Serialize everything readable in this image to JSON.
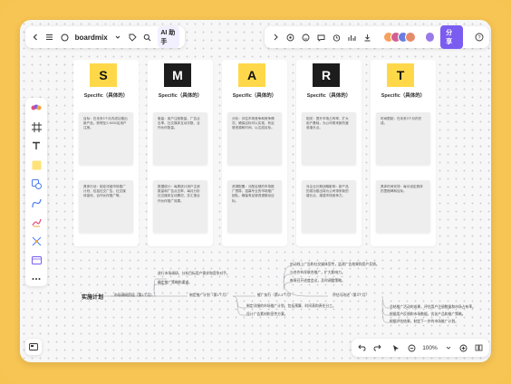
{
  "toolbar_left": {
    "back_icon": "chevron-left-icon",
    "menu_icon": "menu-icon",
    "brand": "boardmix",
    "tag_icon": "tag-icon",
    "search_icon": "search-icon",
    "ai_label": "AI 助手"
  },
  "toolbar_right": {
    "share_label": "分享",
    "help_icon": "help-icon"
  },
  "sidebar": {
    "items": [
      "logo-icon",
      "frame-icon",
      "text-icon",
      "sticky-note-icon",
      "shape-icon",
      "connector-icon",
      "pen-icon",
      "mindmap-icon",
      "template-icon",
      "more-icon"
    ]
  },
  "smart": {
    "columns": [
      {
        "letter": "S",
        "bg": "#ffd84a",
        "fg": "#111111",
        "title": "Specific（具体的）",
        "note1": "目标：在未来3个月内成功推出新产品，获得至少5000名用户注册。",
        "note2": "具体行动：制定详细市场推广计划，包括社交广告、社交媒体宣传、合作伙伴推广等。"
      },
      {
        "letter": "M",
        "bg": "#1d1d1d",
        "fg": "#ffffff",
        "title": "Specific（具体的）",
        "note1": "衡量：用户注册数量、广告点击率、社交媒体互动次数、合作伙伴数量。",
        "note2": "数据统计：每周统计用户注册数量和广告点击率，每月分析社交媒体互动情况，并汇报合作伙伴推广效果。"
      },
      {
        "letter": "A",
        "bg": "#ffd84a",
        "fg": "#111111",
        "title": "Specific（具体的）",
        "note1": "分析：评估市场竞争和竞争情况，确保目标可以实现，有足够资源和时间，以达成目标。",
        "note2": "资源配置：分配足够的市场推广预算，招募专业的市场推广团队，确保有足够资源推动目标。"
      },
      {
        "letter": "R",
        "bg": "#1d1d1d",
        "fg": "#ffffff",
        "title": "Specific（具体的）",
        "note1": "相关：提升市场占有率，扩大用户基础，为公司带来新的营收增长点。",
        "note2": "对企业长期战略影响：新产品的成功推出将为公司带来新的增长点，增强市场竞争力。"
      },
      {
        "letter": "T",
        "bg": "#ffd84a",
        "fg": "#111111",
        "title": "Specific（具体的）",
        "note1": "时间限制：在未来3个月内完成。",
        "note2": "具体时间安排：每月设定具体的里程碑和目标。"
      }
    ]
  },
  "mindmap": {
    "root": "实施计划",
    "branches": [
      "市场调研阶段（第1个月）",
      "制定推广计划（第1个月）",
      "推广执行（第2-3个月）",
      "评估与改进（第3个月）"
    ],
    "leaves": [
      "进行市场调研，分析目标用户需求和竞争对手。",
      "确定推广策略和渠道。",
      "制定详细的市场推广计划，包括预算、时间表和责任分工。",
      "设计广告素材和宣传方案。",
      "启动线上广告和社交媒体宣传，监测广告效果和用户反馈。",
      "与合作伙伴联合推广，扩大影响力。",
      "每周召开进度会议，及时调整策略。",
      "总结推广活动的成果，评估用户注册数量和市场占有率。",
      "根据用户反馈和市场数据，优化产品和推广策略。",
      "根据评估结果，制定下一步的市场推广计划。"
    ]
  },
  "zoom": {
    "level": "100%"
  }
}
